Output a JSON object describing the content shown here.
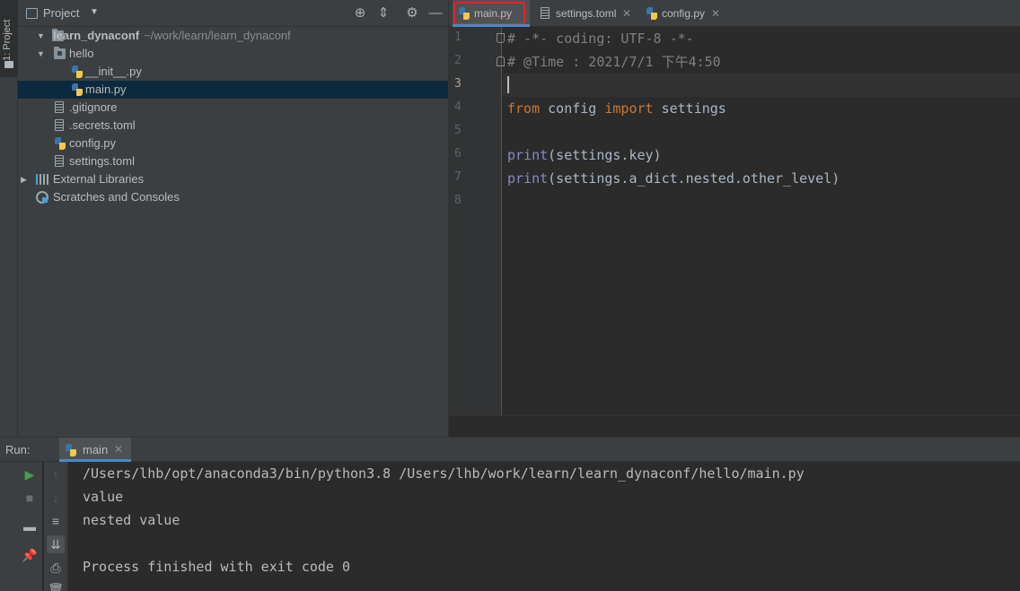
{
  "left_strip": {
    "tab_label": "1: Project"
  },
  "project": {
    "title": "Project",
    "tree": [
      {
        "label": "learn_dynaconf",
        "path": "~/work/learn/learn_dynaconf"
      },
      {
        "label": "hello"
      },
      {
        "label": "__init__.py"
      },
      {
        "label": "main.py"
      },
      {
        "label": ".gitignore"
      },
      {
        "label": ".secrets.toml"
      },
      {
        "label": "config.py"
      },
      {
        "label": "settings.toml"
      },
      {
        "label": "External Libraries"
      },
      {
        "label": "Scratches and Consoles"
      }
    ]
  },
  "editor": {
    "tabs": [
      {
        "label": "main.py",
        "active": true
      },
      {
        "label": "settings.toml"
      },
      {
        "label": "config.py"
      }
    ],
    "line_numbers": [
      "1",
      "2",
      "3",
      "4",
      "5",
      "6",
      "7",
      "8"
    ],
    "current_line": 3,
    "code": {
      "line1": "# -*- coding: UTF-8 -*-",
      "line2": "# @Time : 2021/7/1 下午4:50",
      "line4_kw1": "from",
      "line4_mod": " config ",
      "line4_kw2": "import",
      "line4_name": " settings",
      "line6_fn": "print",
      "line6_args": "(settings.key)",
      "line7_fn": "print",
      "line7_args": "(settings.a_dict.nested.other_level)"
    }
  },
  "run": {
    "label": "Run:",
    "tab_label": "main",
    "console": [
      "/Users/lhb/opt/anaconda3/bin/python3.8 /Users/lhb/work/learn/learn_dynaconf/hello/main.py",
      "value",
      "nested value",
      "",
      "Process finished with exit code 0"
    ]
  },
  "colors": {
    "keyword": "#cc7832",
    "builtin": "#8888c6",
    "comment": "#808080",
    "selection": "#0d293e",
    "tab_highlight_box": "#e8212b",
    "accent": "#4a88c7"
  }
}
